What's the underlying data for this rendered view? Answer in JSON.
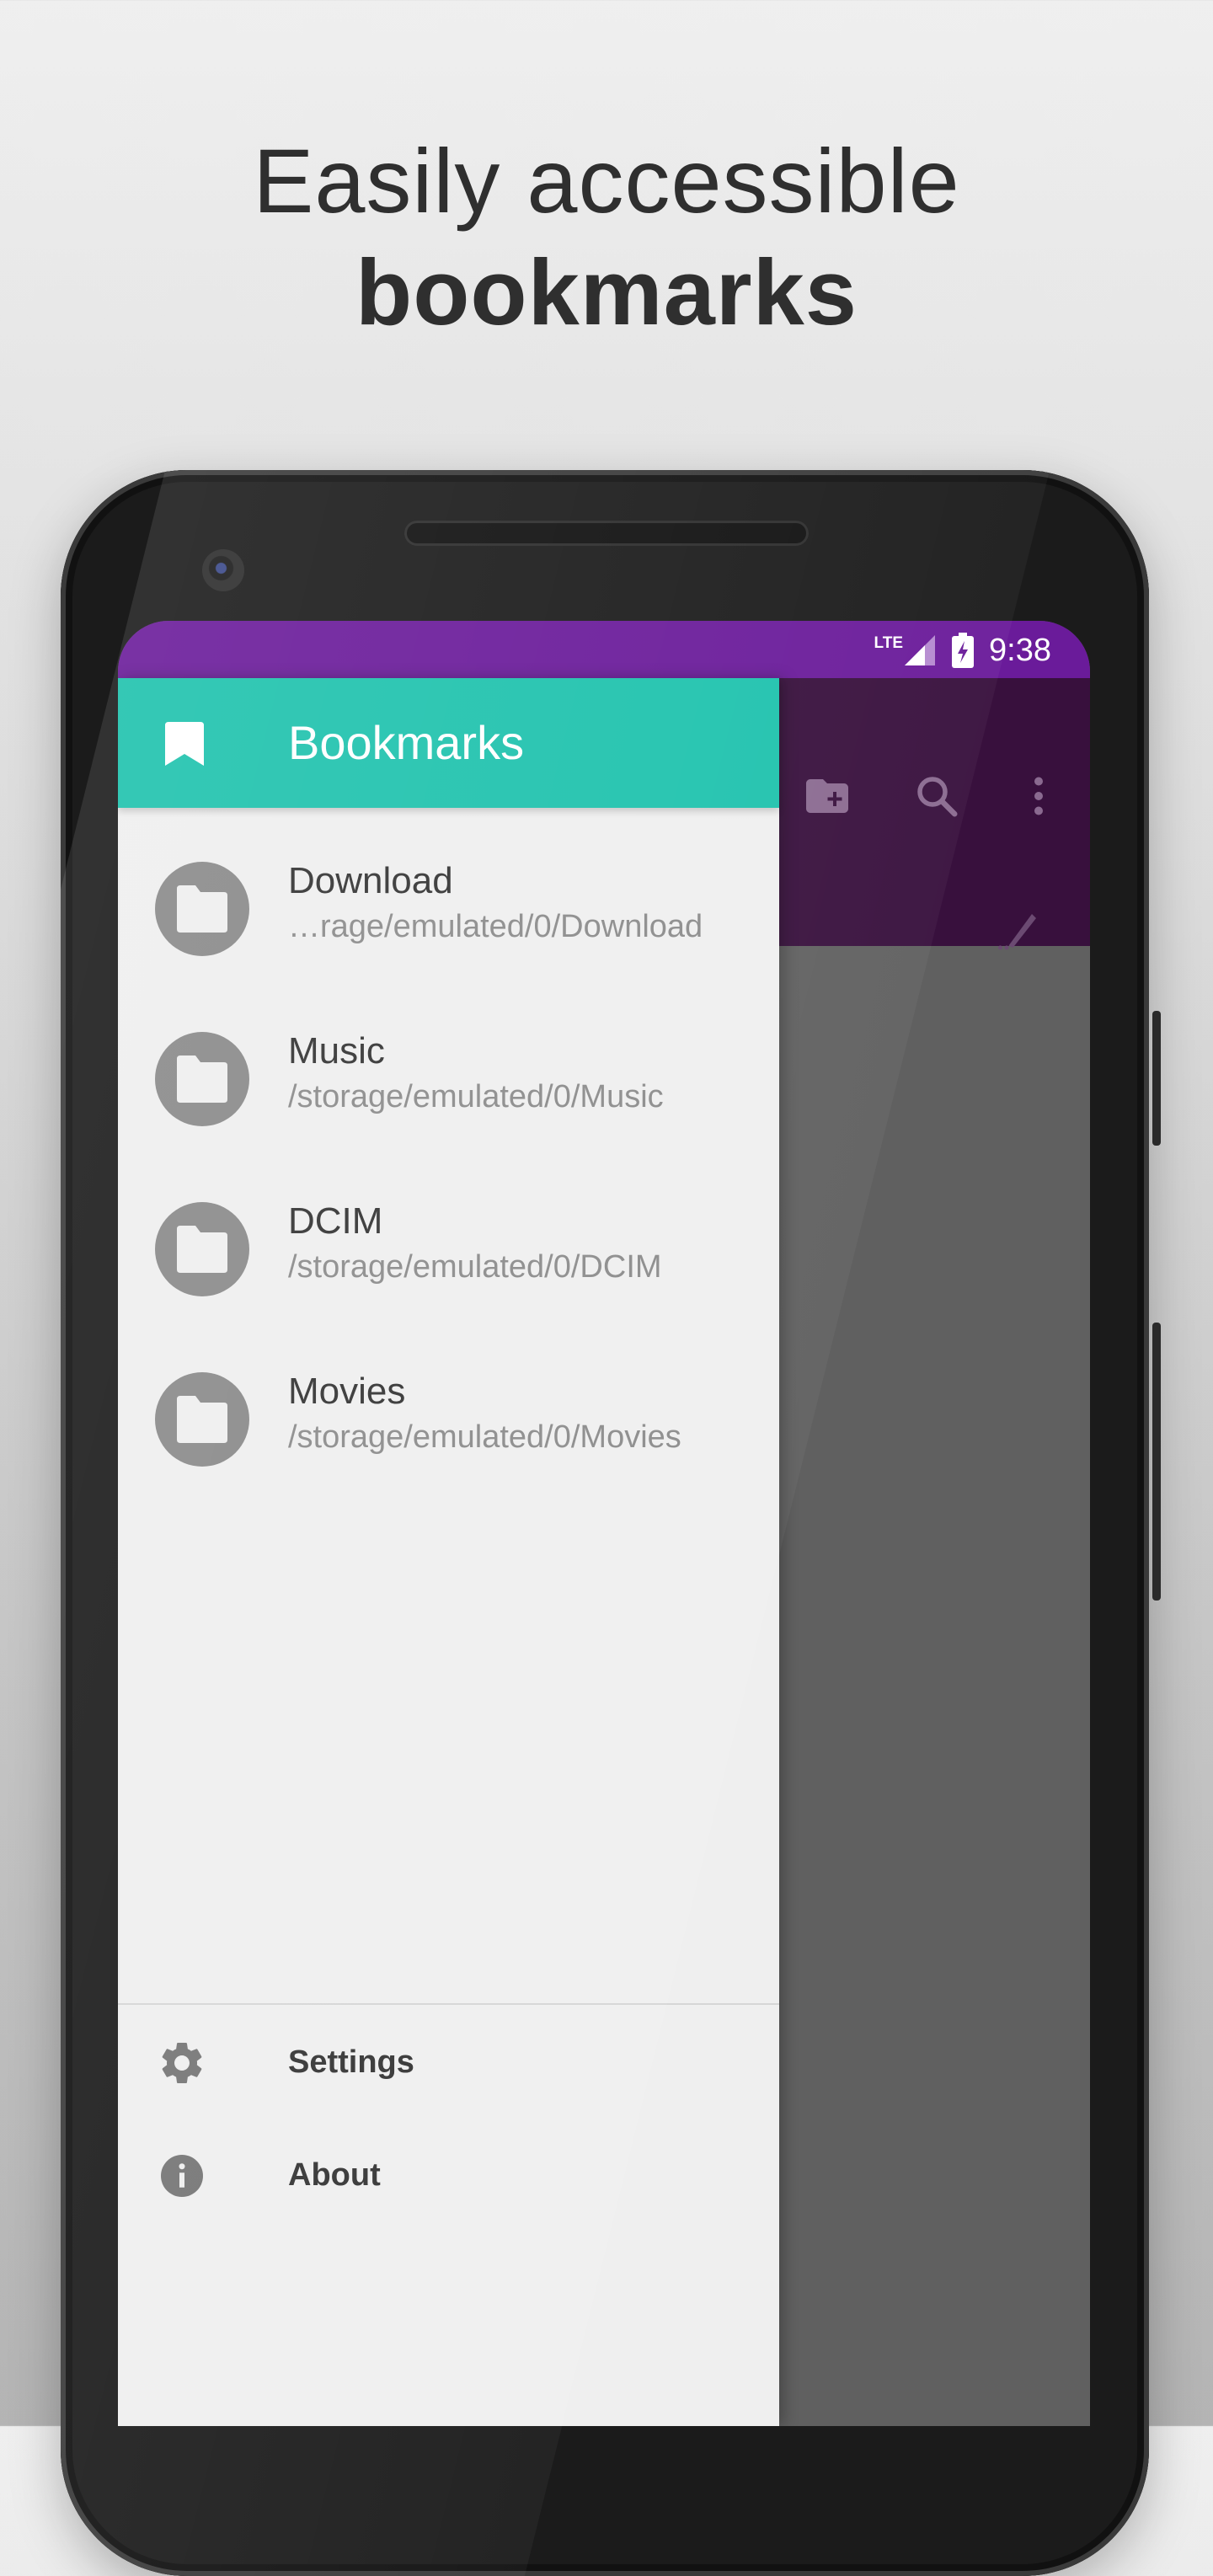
{
  "headline": {
    "line1": "Easily accessible",
    "line2": "bookmarks"
  },
  "status_bar": {
    "network": "LTE",
    "time": "9:38"
  },
  "colors": {
    "status_bar": "#6a1b9a",
    "drawer_header": "#1ec2ad",
    "app_bar_dim": "#38103d",
    "scrim": "#606060"
  },
  "app_bar": {
    "icons": [
      "create-folder-icon",
      "search-icon",
      "more-vert-icon",
      "edit-icon"
    ]
  },
  "drawer": {
    "title": "Bookmarks",
    "bookmarks": [
      {
        "name": "Download",
        "path": "…rage/emulated/0/Download"
      },
      {
        "name": "Music",
        "path": "/storage/emulated/0/Music"
      },
      {
        "name": "DCIM",
        "path": "/storage/emulated/0/DCIM"
      },
      {
        "name": "Movies",
        "path": "/storage/emulated/0/Movies"
      }
    ],
    "footer": {
      "settings_label": "Settings",
      "about_label": "About"
    }
  }
}
